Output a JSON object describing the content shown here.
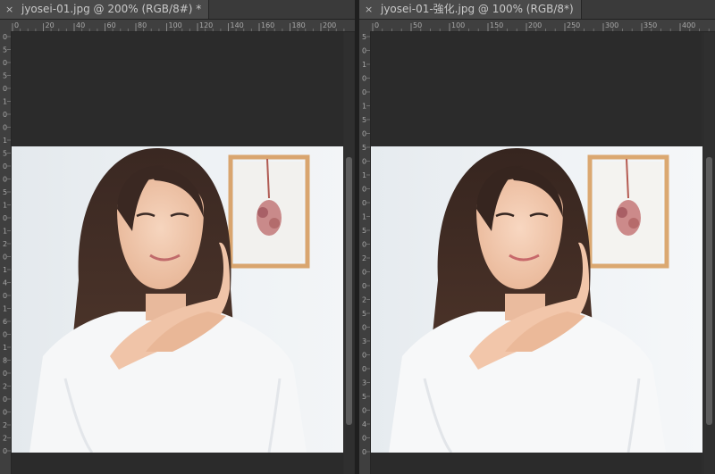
{
  "documents": [
    {
      "tab_close_glyph": "×",
      "tab_title": "jyosei-01.jpg @ 200% (RGB/8#) *",
      "h_ruler_labels": [
        "0",
        "20",
        "40",
        "60",
        "80",
        "100",
        "120",
        "140",
        "160",
        "180",
        "200"
      ],
      "v_ruler_labels": [
        "0",
        "5",
        "0",
        "5",
        "0",
        "1",
        "0",
        "0",
        "1",
        "5",
        "0",
        "0",
        "5",
        "1",
        "0",
        "1",
        "2",
        "0",
        "1",
        "4",
        "0",
        "1",
        "6",
        "0",
        "1",
        "8",
        "0",
        "2",
        "0",
        "0",
        "2",
        "2",
        "0"
      ]
    },
    {
      "tab_close_glyph": "×",
      "tab_title": "jyosei-01-強化.jpg @ 100% (RGB/8*)",
      "h_ruler_labels": [
        "0",
        "50",
        "100",
        "150",
        "200",
        "250",
        "300",
        "350",
        "400"
      ],
      "v_ruler_labels": [
        "5",
        "0",
        "1",
        "0",
        "0",
        "1",
        "5",
        "0",
        "5",
        "0",
        "1",
        "0",
        "0",
        "1",
        "5",
        "0",
        "2",
        "0",
        "0",
        "2",
        "5",
        "0",
        "3",
        "0",
        "0",
        "3",
        "5",
        "0",
        "4",
        "0",
        "0"
      ]
    }
  ],
  "colors": {
    "app_background": "#2b2b2b",
    "tab_active": "#4a4a4a",
    "ruler": "#3f3f3f",
    "wall": "#e9eef2",
    "frame": "#d7a36b",
    "hair": "#3d2a22",
    "skin": "#f0c7ad",
    "shirt": "#f6f7f8"
  }
}
